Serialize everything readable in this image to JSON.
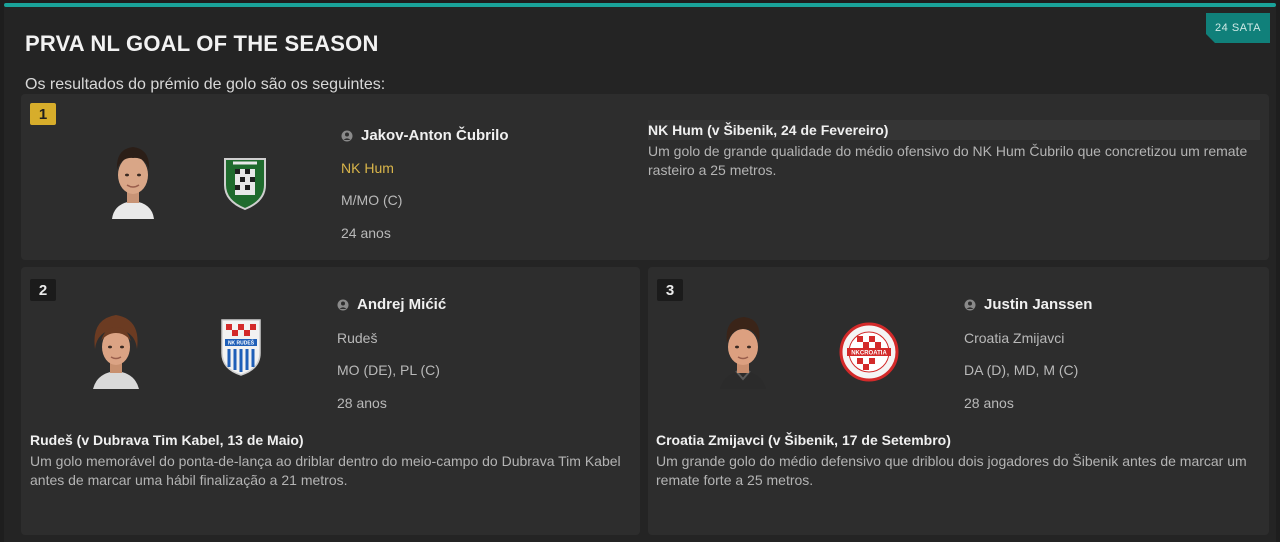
{
  "header": {
    "time_badge": "24 SATA",
    "title": "PRVA NL GOAL OF THE SEASON",
    "subtitle": "Os resultados do prémio de golo são os seguintes:"
  },
  "colors": {
    "accent": "#1aa39a",
    "gold_rank": "#d7ad2b",
    "club_highlight": "#d9b54a"
  },
  "awards": [
    {
      "rank": "1",
      "player": "Jakov-Anton Čubrilo",
      "club": "NK Hum",
      "position": "M/MO (C)",
      "age": "24 anos",
      "goal_title": "NK Hum (v Šibenik, 24 de Fevereiro)",
      "goal_description": "Um golo de grande qualidade do médio ofensivo do NK Hum Čubrilo que concretizou um remate rasteiro a 25 metros.",
      "crest_icon": "nk-hum-crest-icon"
    },
    {
      "rank": "2",
      "player": "Andrej Mićić",
      "club": "Rudeš",
      "position": "MO (DE), PL (C)",
      "age": "28 anos",
      "goal_title": "Rudeš (v Dubrava Tim Kabel, 13 de Maio)",
      "goal_description": "Um golo memorável do ponta-de-lança ao driblar dentro do meio-campo do Dubrava Tim Kabel antes de marcar uma hábil finalização a 21 metros.",
      "crest_icon": "nk-rudes-crest-icon",
      "crest_text": "NK RUDEŠ"
    },
    {
      "rank": "3",
      "player": "Justin Janssen",
      "club": "Croatia Zmijavci",
      "position": "DA (D), MD, M (C)",
      "age": "28 anos",
      "goal_title": "Croatia Zmijavci (v Šibenik, 17 de Setembro)",
      "goal_description": "Um grande golo do médio defensivo que driblou dois jogadores do Šibenik antes de marcar um remate forte a 25 metros.",
      "crest_icon": "croatia-zmijavci-crest-icon",
      "crest_text": "NKCROATIA"
    }
  ]
}
